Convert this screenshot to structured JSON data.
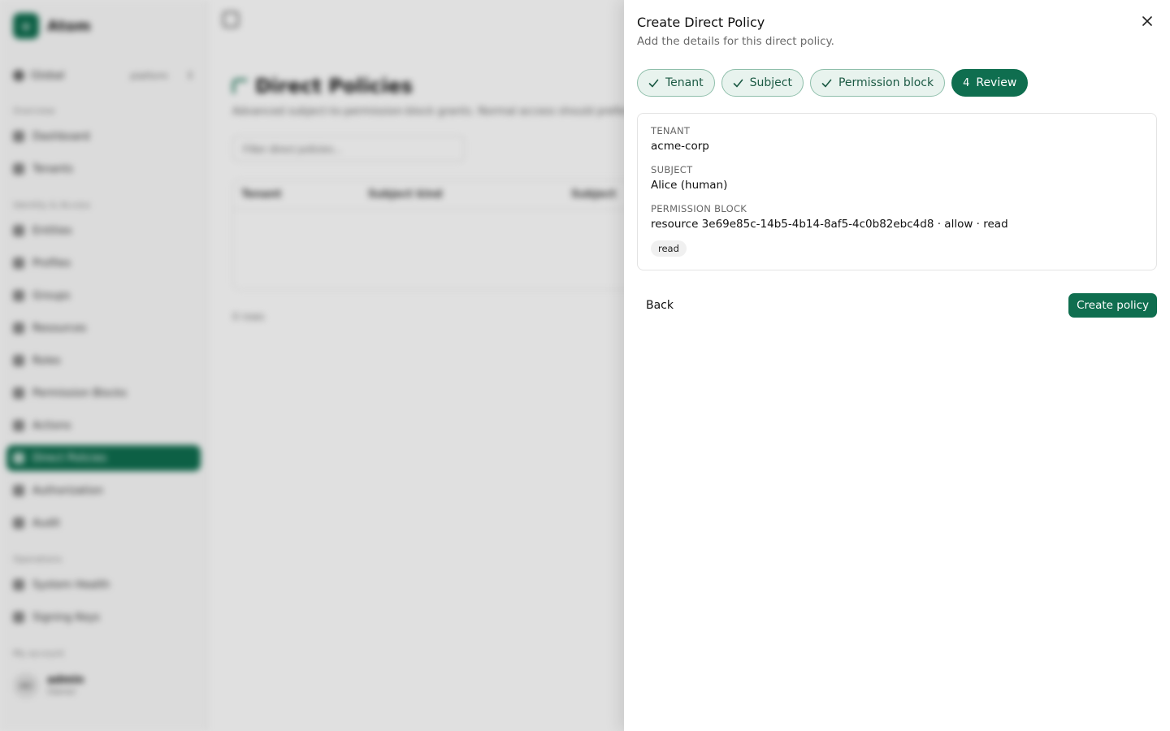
{
  "app": {
    "brand_name": "Atom",
    "brand_logo_glyph": "+",
    "context": {
      "scope": "Global",
      "tag": "platform",
      "selector": "↕"
    },
    "nav": {
      "overview_label": "Overview",
      "overview_items": [
        {
          "label": "Dashboard",
          "icon": "dashboard-icon"
        },
        {
          "label": "Tenants",
          "icon": "building-icon"
        }
      ],
      "identity_label": "Identity & Access",
      "identity_items": [
        {
          "label": "Entities",
          "icon": "entity-icon"
        },
        {
          "label": "Profiles",
          "icon": "profile-icon"
        },
        {
          "label": "Groups",
          "icon": "group-icon"
        },
        {
          "label": "Resources",
          "icon": "resource-icon"
        },
        {
          "label": "Roles",
          "icon": "role-icon"
        },
        {
          "label": "Permission Blocks",
          "icon": "lock-icon"
        },
        {
          "label": "Actions",
          "icon": "action-icon"
        },
        {
          "label": "Direct Policies",
          "icon": "policy-icon"
        },
        {
          "label": "Authorization",
          "icon": "key-icon"
        },
        {
          "label": "Audit",
          "icon": "audit-icon"
        }
      ],
      "operations_label": "Operations",
      "operations_items": [
        {
          "label": "System Health",
          "icon": "health-icon"
        },
        {
          "label": "Signing Keys",
          "icon": "key-icon"
        }
      ],
      "account_label": "My account"
    },
    "user": {
      "initials": "AD",
      "name": "admin",
      "role": "Owner"
    },
    "page": {
      "title": "Direct Policies",
      "subtitle": "Advanced subject-to-permission-block grants. Normal access should prefer roles.",
      "filter_placeholder": "Filter direct policies...",
      "columns": [
        "Tenant",
        "Subject kind",
        "Subject"
      ],
      "count": "0 rows"
    }
  },
  "drawer": {
    "title": "Create Direct Policy",
    "subtitle": "Add the details for this direct policy.",
    "steps": [
      {
        "label": "Tenant",
        "state": "done"
      },
      {
        "label": "Subject",
        "state": "done"
      },
      {
        "label": "Permission block",
        "state": "done"
      },
      {
        "number": "4",
        "label": "Review",
        "state": "current"
      }
    ],
    "review": {
      "tenant_label": "TENANT",
      "tenant_value": "acme-corp",
      "subject_label": "SUBJECT",
      "subject_value": "Alice (human)",
      "block_label": "PERMISSION BLOCK",
      "block_value": "resource 3e69e85c-14b5-4b14-8af5-4c0b82ebc4d8 · allow · read",
      "action_badge": "read"
    },
    "back_label": "Back",
    "create_label": "Create policy"
  },
  "colors": {
    "accent": "#0f6e4f",
    "step_done_bg": "#e8f3ee",
    "step_done_border": "#8fbfab"
  }
}
